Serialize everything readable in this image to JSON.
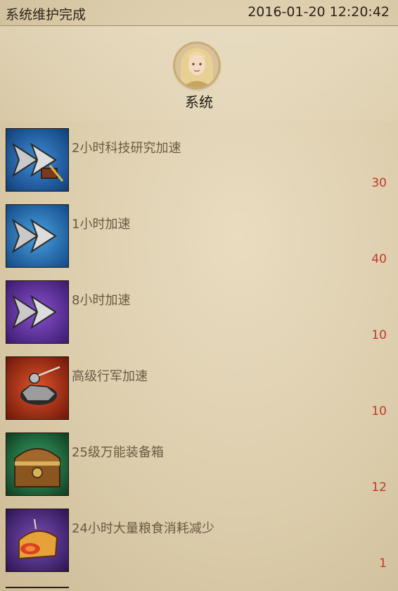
{
  "header": {
    "title": "系统维护完成",
    "datetime": "2016-01-20  12:20:42"
  },
  "sender": {
    "name": "系统",
    "avatar_icon": "elf-portrait-icon"
  },
  "items": [
    {
      "label": "2小时科技研究加速",
      "count": "30",
      "icon": "speedup-research-icon",
      "bg": "#1b5fa8"
    },
    {
      "label": "1小时加速",
      "count": "40",
      "icon": "speedup-icon",
      "bg": "#1a6fb8"
    },
    {
      "label": "8小时加速",
      "count": "10",
      "icon": "speedup-icon",
      "bg": "#5a2a9a"
    },
    {
      "label": "高级行军加速",
      "count": "10",
      "icon": "march-speedup-icon",
      "bg": "#b8381e"
    },
    {
      "label": "25级万能装备箱",
      "count": "12",
      "icon": "treasure-chest-icon",
      "bg": "#1f6b3c"
    },
    {
      "label": "24小时大量粮食消耗减少",
      "count": "1",
      "icon": "food-bread-icon",
      "bg": "#4a2a7a"
    }
  ]
}
